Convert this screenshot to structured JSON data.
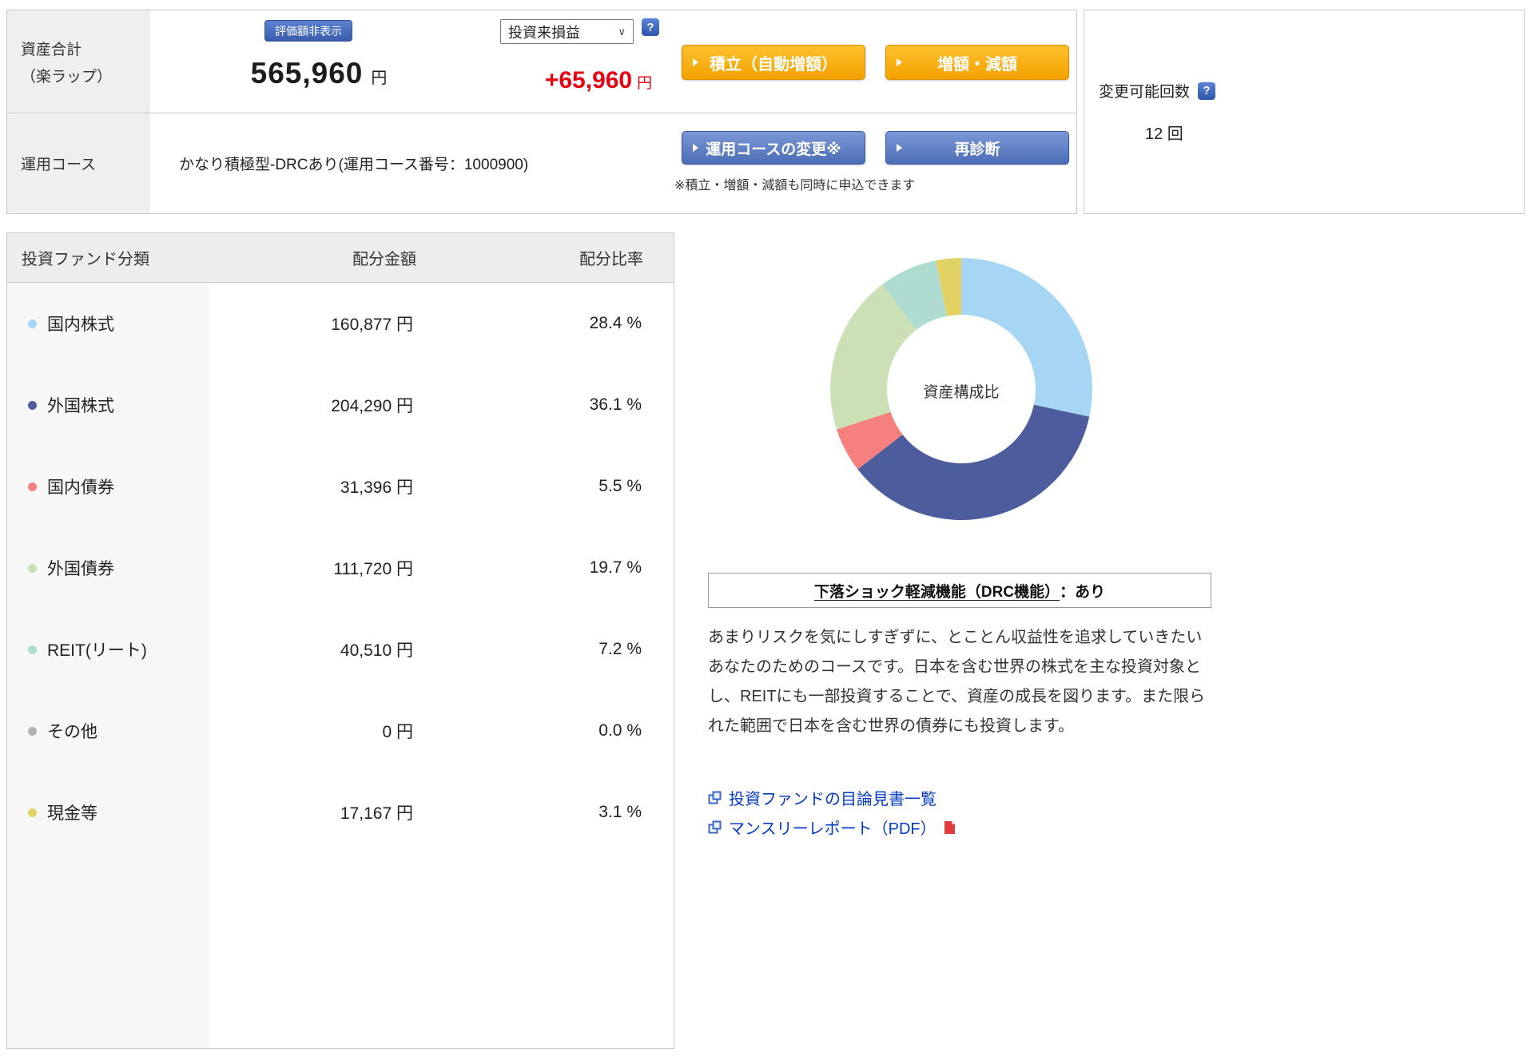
{
  "icons": {
    "help": "?",
    "caret": "∨"
  },
  "top": {
    "asset_label_line1": "資産合計",
    "asset_label_line2": "（楽ラップ）",
    "hide_value_badge": "評価額非表示",
    "total_value": "565,960",
    "total_unit": "円",
    "pl_dropdown_value": "投資来損益",
    "pl_value": "+65,960",
    "pl_unit": "円",
    "btn_tsumitate": "積立（自動増額）",
    "btn_zogaku": "増額・減額",
    "course_label": "運用コース",
    "course_value": "かなり積極型-DRCあり(運用コース番号：1000900)",
    "btn_course_change": "運用コースの変更※",
    "btn_rediagnose": "再診断",
    "note": "※積立・増額・減額も同時に申込できます",
    "change_count_label": "変更可能回数",
    "change_count_value": "12 回"
  },
  "table": {
    "headers": [
      "投資ファンド分類",
      "配分金額",
      "配分比率"
    ],
    "rows": [
      {
        "label": "国内株式",
        "color": "#a6d6f3",
        "amount": "160,877 円",
        "ratio": "28.4 %"
      },
      {
        "label": "外国株式",
        "color": "#4d5c9d",
        "amount": "204,290 円",
        "ratio": "36.1 %"
      },
      {
        "label": "国内債券",
        "color": "#f67f7f",
        "amount": "31,396 円",
        "ratio": "5.5 %"
      },
      {
        "label": "外国債券",
        "color": "#cbe0b5",
        "amount": "111,720 円",
        "ratio": "19.7 %"
      },
      {
        "label": "REIT(リート)",
        "color": "#aedcd0",
        "amount": "40,510 円",
        "ratio": "7.2 %"
      },
      {
        "label": "その他",
        "color": "#b3b3b3",
        "amount": "0 円",
        "ratio": "0.0 %"
      },
      {
        "label": "現金等",
        "color": "#e2d264",
        "amount": "17,167 円",
        "ratio": "3.1 %"
      }
    ]
  },
  "chart_data": {
    "type": "pie",
    "donut": true,
    "center_label": "資産構成比",
    "categories": [
      "国内株式",
      "外国株式",
      "国内債券",
      "外国債券",
      "REIT(リート)",
      "その他",
      "現金等"
    ],
    "values": [
      28.4,
      36.1,
      5.5,
      19.7,
      7.2,
      0.0,
      3.1
    ],
    "colors": [
      "#a6d6f3",
      "#4d5c9d",
      "#f67f7f",
      "#cbe0b5",
      "#aedcd0",
      "#b3b3b3",
      "#e2d264"
    ],
    "legend_position": "none"
  },
  "drc": {
    "title_underlined": "下落ショック軽減機能（DRC機能）",
    "title_suffix": "：あり",
    "description": "あまりリスクを気にしすぎずに、とことん収益性を追求していきたいあなたのためのコースです。日本を含む世界の株式を主な投資対象とし、REITにも一部投資することで、資産の成長を図ります。また限られた範囲で日本を含む世界の債券にも投資します。",
    "links": [
      {
        "label": "投資ファンドの目論見書一覧"
      },
      {
        "label": "マンスリーレポート（PDF）"
      }
    ]
  }
}
